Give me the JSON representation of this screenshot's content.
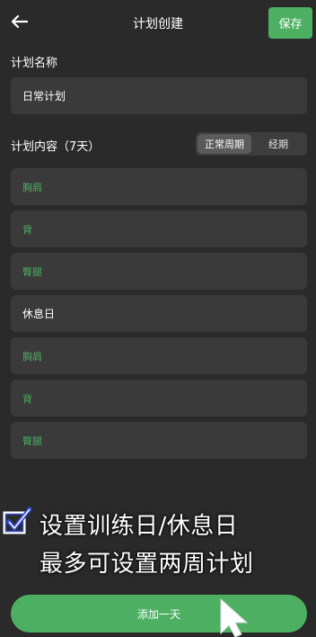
{
  "header": {
    "back_icon": "arrow-left-icon",
    "title": "计划创建",
    "save_label": "保存"
  },
  "plan_name": {
    "label": "计划名称",
    "value": "日常计划"
  },
  "plan_content": {
    "label": "计划内容（7天）",
    "segment": {
      "options": [
        "正常周期",
        "经期"
      ],
      "selected": "正常周期"
    },
    "days": [
      {
        "label": "胸肩",
        "type": "train"
      },
      {
        "label": "背",
        "type": "train"
      },
      {
        "label": "臀腿",
        "type": "train"
      },
      {
        "label": "休息日",
        "type": "rest"
      },
      {
        "label": "胸肩",
        "type": "train"
      },
      {
        "label": "背",
        "type": "train"
      },
      {
        "label": "臀腿",
        "type": "train"
      }
    ]
  },
  "overlay": {
    "icon": "checkbox-checked-icon",
    "line1": "设置训练日/休息日",
    "line2": "最多可设置两周计划"
  },
  "add_day_label": "添加一天",
  "colors": {
    "background": "#2a2a2a",
    "card": "#3a3a3a",
    "accent": "#4caf62",
    "text": "#ffffff"
  }
}
